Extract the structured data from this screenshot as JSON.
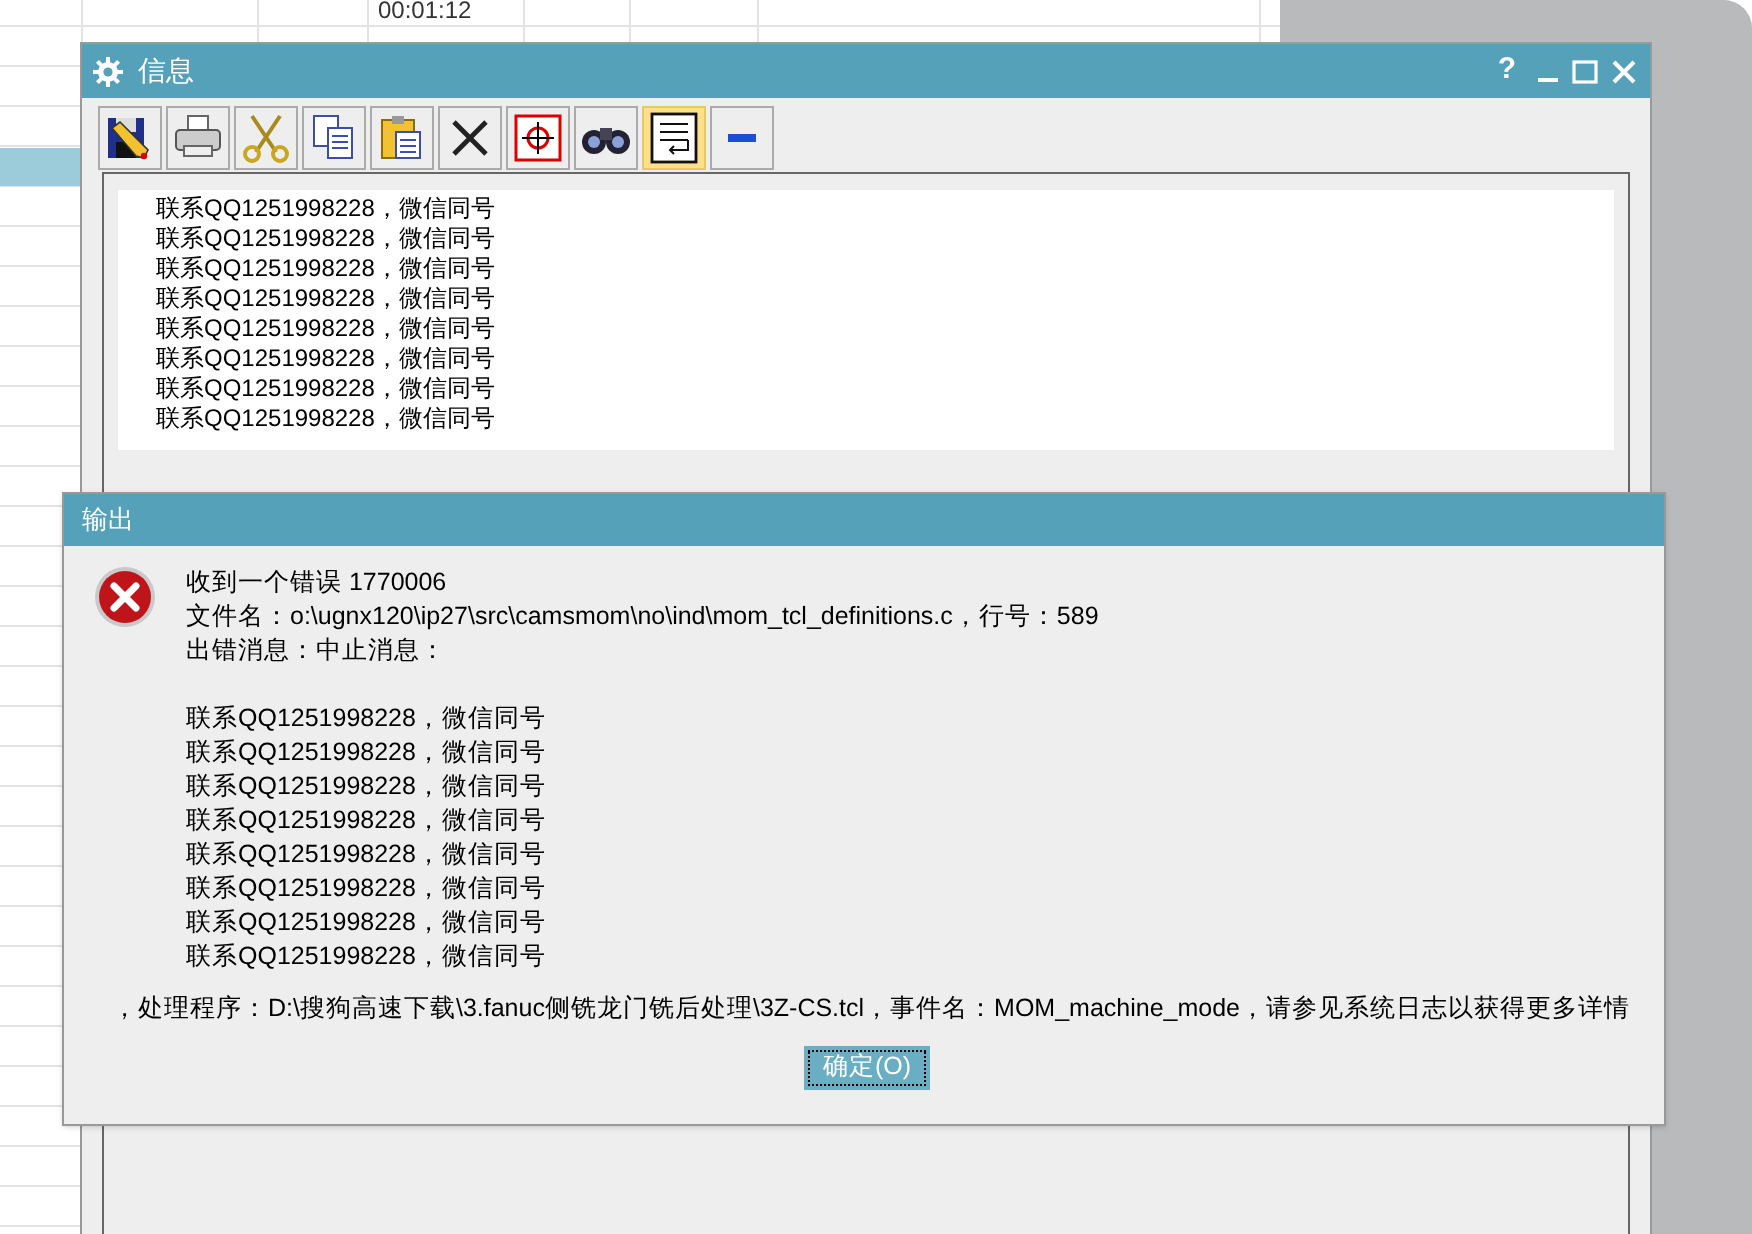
{
  "background_sheet": {
    "cell": "00:01:12"
  },
  "info_window": {
    "title": "信息",
    "title_buttons": [
      {
        "kind": "help",
        "label": "?"
      },
      {
        "kind": "minimize"
      },
      {
        "kind": "maximize"
      },
      {
        "kind": "close"
      }
    ],
    "toolbar": [
      {
        "kind": "save",
        "selected": false
      },
      {
        "kind": "print",
        "selected": false
      },
      {
        "kind": "cut",
        "selected": false
      },
      {
        "kind": "copy",
        "selected": false
      },
      {
        "kind": "paste",
        "selected": false
      },
      {
        "kind": "delete",
        "selected": false
      },
      {
        "kind": "target",
        "selected": false
      },
      {
        "kind": "find",
        "selected": false
      },
      {
        "kind": "wrap",
        "selected": true
      },
      {
        "kind": "collapse",
        "selected": false
      }
    ],
    "lines": [
      "联系QQ1251998228，微信同号",
      "联系QQ1251998228，微信同号",
      "联系QQ1251998228，微信同号",
      "联系QQ1251998228，微信同号",
      "联系QQ1251998228，微信同号",
      "联系QQ1251998228，微信同号",
      "联系QQ1251998228，微信同号",
      "联系QQ1251998228，微信同号"
    ]
  },
  "output_dialog": {
    "title": "输出",
    "message_lines": [
      "收到一个错误 1770006",
      "文件名：o:\\ugnx120\\ip27\\src\\camsmom\\no\\ind\\mom_tcl_definitions.c，行号：589",
      "出错消息：中止消息："
    ],
    "contact_lines": [
      "联系QQ1251998228，微信同号",
      "联系QQ1251998228，微信同号",
      "联系QQ1251998228，微信同号",
      "联系QQ1251998228，微信同号",
      "联系QQ1251998228，微信同号",
      "联系QQ1251998228，微信同号",
      "联系QQ1251998228，微信同号",
      "联系QQ1251998228，微信同号"
    ],
    "handler_line": "，处理程序：D:\\搜狗高速下载\\3.fanuc侧铣龙门铣后处理\\3Z-CS.tcl，事件名：MOM_machine_mode，请参见系统日志以获得更多详情",
    "ok_button": "确定(O)"
  }
}
